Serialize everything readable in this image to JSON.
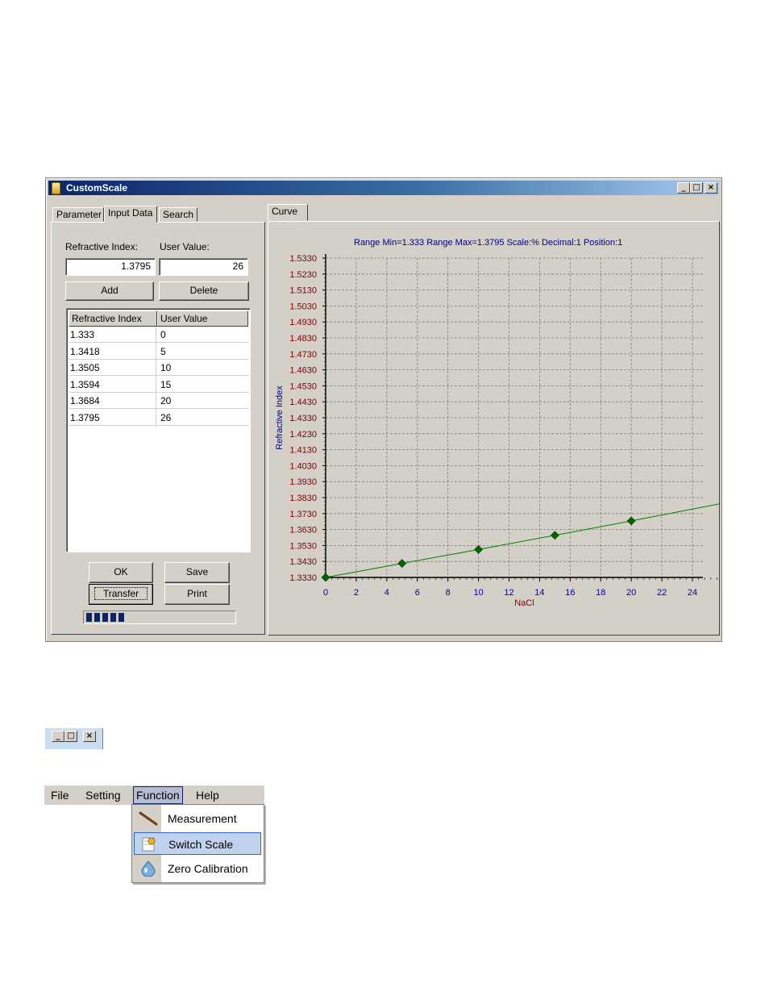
{
  "window": {
    "title": "CustomScale",
    "caption_buttons": [
      "_",
      "□",
      "×"
    ]
  },
  "left_tabs": [
    "Parameter",
    "Input Data",
    "Search"
  ],
  "active_left_tab": "Input Data",
  "input": {
    "ri_label": "Refractive Index:",
    "uv_label": "User Value:",
    "ri_value": "1.3795",
    "uv_value": "26",
    "add_label": "Add",
    "delete_label": "Delete"
  },
  "table": {
    "headers": [
      "Refractive Index",
      "User Value"
    ],
    "rows": [
      [
        "1.333",
        "0"
      ],
      [
        "1.3418",
        "5"
      ],
      [
        "1.3505",
        "10"
      ],
      [
        "1.3594",
        "15"
      ],
      [
        "1.3684",
        "20"
      ],
      [
        "1.3795",
        "26"
      ]
    ]
  },
  "buttons": {
    "ok": "OK",
    "save": "Save",
    "transfer": "Transfer",
    "print": "Print"
  },
  "progress": {
    "blocks": 5
  },
  "right_tab": "Curve",
  "chart_data": {
    "type": "line",
    "title": "Range Min=1.333 Range Max=1.3795 Scale:% Decimal:1 Position:1",
    "xlabel": "NaCl",
    "ylabel": "Refractive Index",
    "xlim": [
      0,
      26
    ],
    "ylim": [
      1.333,
      1.533
    ],
    "x_ticks": [
      "0",
      "2",
      "4",
      "6",
      "8",
      "10",
      "12",
      "14",
      "16",
      "18",
      "20",
      "22",
      "24"
    ],
    "y_ticks": [
      "1.5330",
      "1.5230",
      "1.5130",
      "1.5030",
      "1.4930",
      "1.4830",
      "1.4730",
      "1.4630",
      "1.4530",
      "1.4430",
      "1.4330",
      "1.4230",
      "1.4130",
      "1.4030",
      "1.3930",
      "1.3830",
      "1.3730",
      "1.3630",
      "1.3530",
      "1.3430",
      "1.3330"
    ],
    "grid": true,
    "series": [
      {
        "points": [
          [
            0,
            1.333
          ],
          [
            5,
            1.3418
          ],
          [
            10,
            1.3505
          ],
          [
            15,
            1.3594
          ],
          [
            20,
            1.3684
          ],
          [
            26,
            1.3795
          ]
        ]
      }
    ],
    "colors": {
      "line": "#008000",
      "marker": "#006400",
      "title": "#000080",
      "ylabels": "#800000",
      "xlabels": "#0000a0"
    }
  },
  "caption_snippet": [
    "_",
    "□",
    "×"
  ],
  "menubar": {
    "items": [
      "File",
      "Setting",
      "Function",
      "Help"
    ],
    "active": "Function"
  },
  "function_menu": [
    {
      "label": "Measurement",
      "icon": "measurement-stick-icon"
    },
    {
      "label": "Switch Scale",
      "icon": "switch-scale-icon",
      "highlighted": true
    },
    {
      "label": "Zero Calibration",
      "icon": "water-drop-icon"
    }
  ]
}
